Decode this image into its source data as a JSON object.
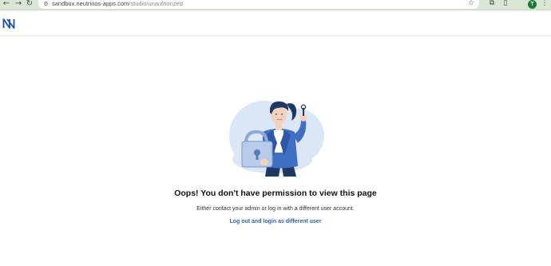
{
  "browser": {
    "url_domain": "sandbox.neutrinos-apps.com",
    "url_path": "/studio/unauthorized",
    "profile_initial": "T",
    "icons": [
      "back-icon",
      "forward-icon",
      "reload-icon",
      "site-info-icon",
      "bookmark-star-icon",
      "extensions-icon",
      "sidepanel-icon",
      "more-menu-icon"
    ]
  },
  "app": {
    "logo_icon": "neutrinos-logo-icon",
    "brand_color": "#1f4fa8"
  },
  "main": {
    "title": "Oops! You don't have permission to view this page",
    "message": "Either contact your admin or log in with a different user account.",
    "logout_link": "Log out and login as different user",
    "link_color": "#2f5fb3"
  }
}
